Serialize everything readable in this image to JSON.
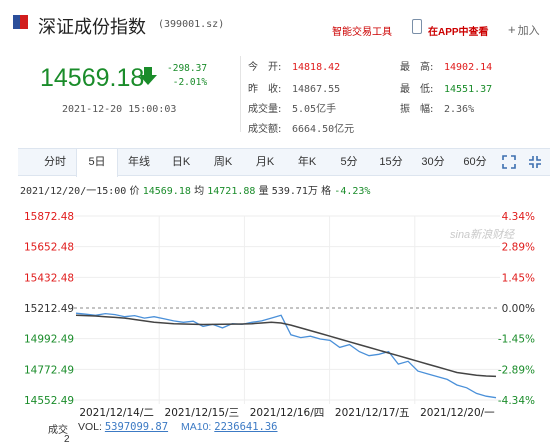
{
  "header": {
    "title": "深证成份指数",
    "code": "(399001.sz)",
    "tools_label": "智能交易工具",
    "app_label": "在APP中查看",
    "add_label": "加入"
  },
  "quote": {
    "price": "14569.18",
    "change": "-298.37",
    "change_pct": "-2.01%",
    "datetime": "2021-12-20 15:00:03"
  },
  "stats": {
    "open_label": "今　开:",
    "open": "14818.42",
    "prev_close_label": "昨　收:",
    "prev_close": "14867.55",
    "volume_label": "成交量:",
    "volume": "5.05亿手",
    "amount_label": "成交额:",
    "amount": "6664.50亿元",
    "high_label": "最　高:",
    "high": "14902.14",
    "low_label": "最　低:",
    "low": "14551.37",
    "amplitude_label": "振　幅:",
    "amplitude": "2.36%"
  },
  "tabs": [
    "分时",
    "5日",
    "年线",
    "日K",
    "周K",
    "月K",
    "年K",
    "5分",
    "15分",
    "30分",
    "60分"
  ],
  "active_tab": "5日",
  "info_line": {
    "time": "2021/12/20/一15:00",
    "price_label": "价",
    "price": "14569.18",
    "avg_label": "均",
    "avg": "14721.88",
    "vol_label": "量",
    "vol": "539.71万",
    "pct_label": "格",
    "pct": "-4.23%"
  },
  "watermark": "sina新浪财经",
  "chart_data": {
    "type": "line",
    "y_ticks_left": [
      "15872.48",
      "15652.48",
      "15432.48",
      "15212.49",
      "14992.49",
      "14772.49",
      "14552.49"
    ],
    "y_ticks_right": [
      "4.34%",
      "2.89%",
      "1.45%",
      "0.00%",
      "-1.45%",
      "-2.89%",
      "-4.34%"
    ],
    "baseline": 15212.49,
    "ylim": [
      14552.49,
      15872.48
    ],
    "categories": [
      "2021/12/14/二",
      "2021/12/15/三",
      "2021/12/16/四",
      "2021/12/17/五",
      "2021/12/20/一"
    ],
    "series": [
      {
        "values": [
          15175,
          15168,
          15160,
          15172,
          15165,
          15150,
          15158,
          15140,
          15150,
          15135,
          15120,
          15110,
          15118,
          15080,
          15095,
          15070,
          15100,
          15095,
          15110,
          15120,
          15140,
          15160,
          15020,
          15000,
          15010,
          14990,
          14980,
          14930,
          14950,
          14900,
          14870,
          14880,
          14900,
          14810,
          14830,
          14760,
          14740,
          14720,
          14700,
          14660,
          14640,
          14600,
          14580,
          14569
        ]
      },
      {
        "values": [
          15160,
          15158,
          15155,
          15150,
          15145,
          15140,
          15130,
          15120,
          15110,
          15105,
          15100,
          15098,
          15096,
          15094,
          15095,
          15096,
          15097,
          15098,
          15100,
          15105,
          15110,
          15105,
          15090,
          15070,
          15050,
          15030,
          15010,
          14990,
          14970,
          14950,
          14930,
          14910,
          14890,
          14870,
          14850,
          14830,
          14810,
          14790,
          14770,
          14750,
          14740,
          14730,
          14725,
          14722
        ]
      }
    ]
  },
  "volume": {
    "label": "成交",
    "label2": "2",
    "vol_label": "VOL:",
    "vol": "5397099.87",
    "ma10_label": "MA10:",
    "ma10": "2236641.36"
  }
}
